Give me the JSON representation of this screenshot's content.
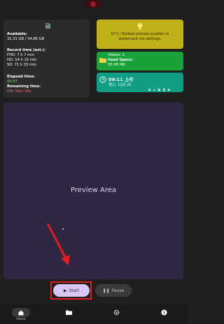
{
  "storage": {
    "available_label": "Available:",
    "available_value": "31.31 GB / 34.86 GB",
    "record_time_label": "Record time (est.):",
    "fhd": "FHD: 7 h 7 min",
    "hd": "HD: 14 h 15 min",
    "sd": "SD: 71 h 15 min",
    "elapsed_label": "Elapsed time:",
    "elapsed_value": "00:07",
    "remaining_label": "Remaining time:",
    "remaining_value": "14h 56m 34s"
  },
  "tip": {
    "text": "6/*1 | Embed precise location in watermark via settings."
  },
  "videos": {
    "videos_line": "Videos: 2",
    "used_label": "Used Space:",
    "used_value": "55.08 MB"
  },
  "clock": {
    "time": "09:11 上午",
    "date": "周三, 11月 20"
  },
  "preview": {
    "label": "Preview Area"
  },
  "controls": {
    "start_label": "Start",
    "pause_label": "Pause"
  },
  "nav": {
    "home_label": "Home"
  },
  "colors": {
    "tip_bg": "#c0b019",
    "videos_bg": "#19a23a",
    "time_bg": "#119e84",
    "preview_bg": "#2f2742",
    "start_bg": "#d9c6f5",
    "highlight": "#e11b22"
  }
}
